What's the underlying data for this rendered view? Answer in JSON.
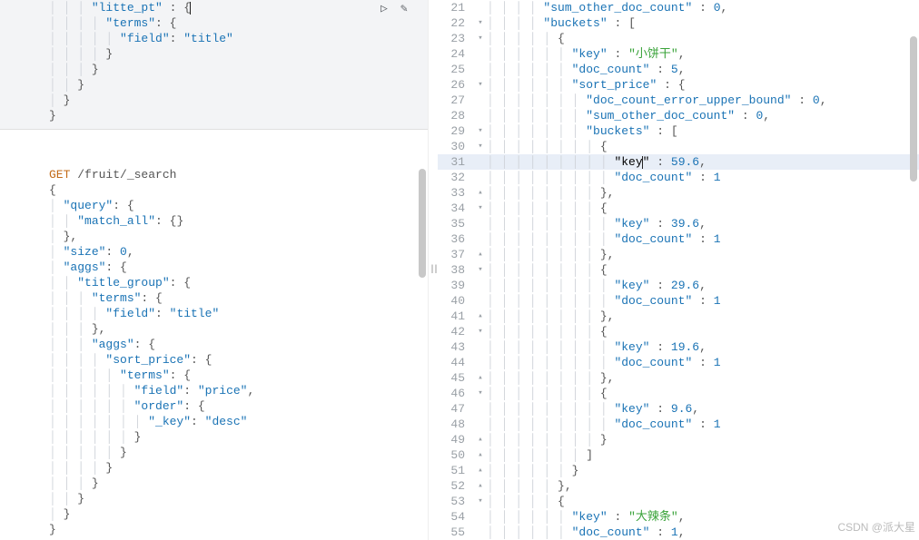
{
  "left": {
    "block1": [
      "      \"litte_pt\" : {|",
      "        \"terms\": {",
      "          \"field\": \"title\"",
      "        }",
      "      }",
      "    }",
      "  }",
      "}"
    ],
    "block2": [
      {
        "t": "",
        "plain": true
      },
      {
        "t": "GET /fruit/_search",
        "method": true
      },
      {
        "t": "{",
        "plain": true
      },
      {
        "t": "  \"query\": {"
      },
      {
        "t": "    \"match_all\": {}"
      },
      {
        "t": "  },"
      },
      {
        "t": "  \"size\": 0,"
      },
      {
        "t": "  \"aggs\": {"
      },
      {
        "t": "    \"title_group\": {"
      },
      {
        "t": "      \"terms\": {"
      },
      {
        "t": "        \"field\": \"title\""
      },
      {
        "t": "      },"
      },
      {
        "t": "      \"aggs\": {"
      },
      {
        "t": "        \"sort_price\": {"
      },
      {
        "t": "          \"terms\": {"
      },
      {
        "t": "            \"field\": \"price\","
      },
      {
        "t": "            \"order\": {"
      },
      {
        "t": "              \"_key\": \"desc\""
      },
      {
        "t": "            }"
      },
      {
        "t": "          }"
      },
      {
        "t": "        }"
      },
      {
        "t": "      }"
      },
      {
        "t": "    }"
      },
      {
        "t": "  }"
      },
      {
        "t": "}",
        "plain": true
      }
    ]
  },
  "right": [
    {
      "n": 21,
      "t": "        \"sum_other_doc_count\" : 0,"
    },
    {
      "n": 22,
      "f": "▾",
      "t": "        \"buckets\" : ["
    },
    {
      "n": 23,
      "f": "▾",
      "t": "          {"
    },
    {
      "n": 24,
      "t": "            \"key\" : \"小饼干\",",
      "cn": true
    },
    {
      "n": 25,
      "t": "            \"doc_count\" : 5,"
    },
    {
      "n": 26,
      "f": "▾",
      "t": "            \"sort_price\" : {"
    },
    {
      "n": 27,
      "t": "              \"doc_count_error_upper_bound\" : 0,"
    },
    {
      "n": 28,
      "t": "              \"sum_other_doc_count\" : 0,"
    },
    {
      "n": 29,
      "f": "▾",
      "t": "              \"buckets\" : ["
    },
    {
      "n": 30,
      "f": "▾",
      "t": "                {"
    },
    {
      "n": 31,
      "t": "                  \"key|\" : 59.6,",
      "hl": true
    },
    {
      "n": 32,
      "t": "                  \"doc_count\" : 1"
    },
    {
      "n": 33,
      "f": "▴",
      "t": "                },"
    },
    {
      "n": 34,
      "f": "▾",
      "t": "                {"
    },
    {
      "n": 35,
      "t": "                  \"key\" : 39.6,"
    },
    {
      "n": 36,
      "t": "                  \"doc_count\" : 1"
    },
    {
      "n": 37,
      "f": "▴",
      "t": "                },"
    },
    {
      "n": 38,
      "f": "▾",
      "t": "                {"
    },
    {
      "n": 39,
      "t": "                  \"key\" : 29.6,"
    },
    {
      "n": 40,
      "t": "                  \"doc_count\" : 1"
    },
    {
      "n": 41,
      "f": "▴",
      "t": "                },"
    },
    {
      "n": 42,
      "f": "▾",
      "t": "                {"
    },
    {
      "n": 43,
      "t": "                  \"key\" : 19.6,"
    },
    {
      "n": 44,
      "t": "                  \"doc_count\" : 1"
    },
    {
      "n": 45,
      "f": "▴",
      "t": "                },"
    },
    {
      "n": 46,
      "f": "▾",
      "t": "                {"
    },
    {
      "n": 47,
      "t": "                  \"key\" : 9.6,"
    },
    {
      "n": 48,
      "t": "                  \"doc_count\" : 1"
    },
    {
      "n": 49,
      "f": "▴",
      "t": "                }"
    },
    {
      "n": 50,
      "f": "▴",
      "t": "              ]"
    },
    {
      "n": 51,
      "f": "▴",
      "t": "            }"
    },
    {
      "n": 52,
      "f": "▴",
      "t": "          },"
    },
    {
      "n": 53,
      "f": "▾",
      "t": "          {"
    },
    {
      "n": 54,
      "t": "            \"key\" : \"大辣条\",",
      "cn": true
    },
    {
      "n": 55,
      "t": "            \"doc_count\" : 1,"
    }
  ],
  "icons": {
    "run": "▷",
    "wrench": "✎"
  },
  "watermark": "CSDN @派大星"
}
